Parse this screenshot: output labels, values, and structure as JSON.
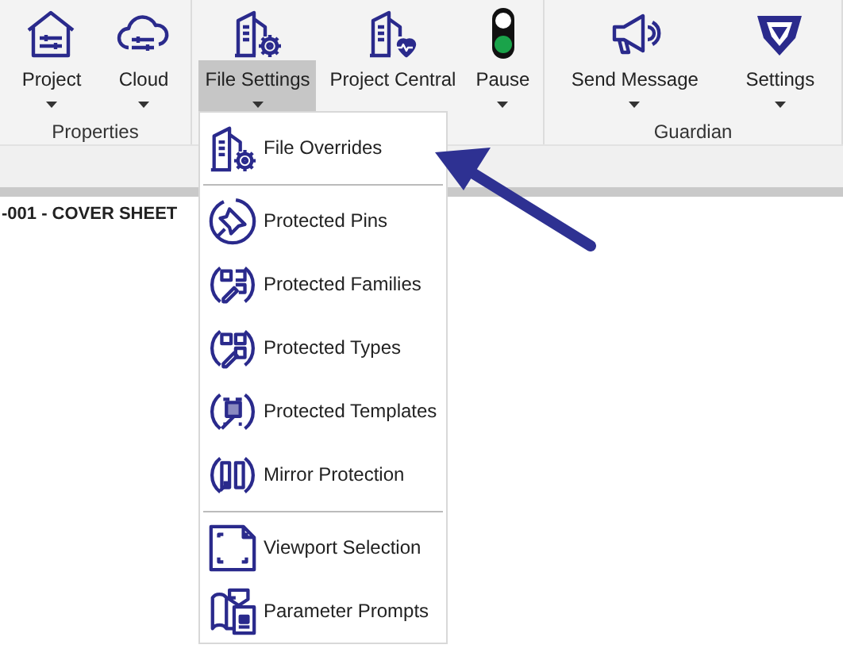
{
  "ribbon": {
    "groups": [
      {
        "label": "Properties",
        "buttons": [
          {
            "label": "Project",
            "dropdown": true,
            "selected": false
          },
          {
            "label": "Cloud",
            "dropdown": true,
            "selected": false
          }
        ]
      },
      {
        "buttons": [
          {
            "label": "File Settings",
            "dropdown": true,
            "selected": true
          },
          {
            "label": "Project Central",
            "dropdown": false,
            "selected": false
          },
          {
            "label": "Pause",
            "dropdown": true,
            "selected": false
          }
        ]
      },
      {
        "label": "Guardian",
        "buttons": [
          {
            "label": "Send Message",
            "dropdown": true,
            "selected": false
          },
          {
            "label": "Settings",
            "dropdown": true,
            "selected": false
          }
        ]
      }
    ]
  },
  "document_tab": {
    "title": "-001 - COVER SHEET"
  },
  "dropdown_menu": {
    "sections": [
      [
        {
          "label": "File Overrides"
        }
      ],
      [
        {
          "label": "Protected Pins"
        },
        {
          "label": "Protected Families"
        },
        {
          "label": "Protected Types"
        },
        {
          "label": "Protected Templates"
        },
        {
          "label": "Mirror Protection"
        }
      ],
      [
        {
          "label": "Viewport Selection"
        },
        {
          "label": "Parameter Prompts"
        }
      ]
    ]
  }
}
